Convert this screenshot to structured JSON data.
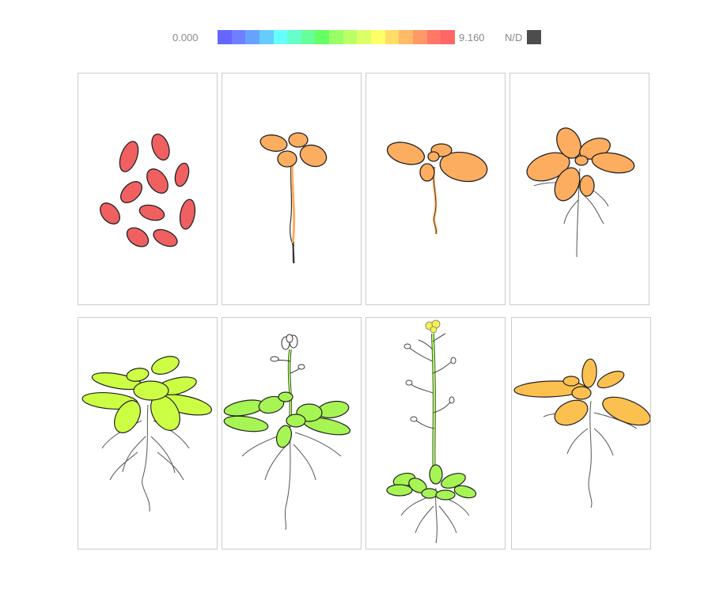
{
  "legend": {
    "min_label": "0.000",
    "max_label": "9.160",
    "nd_label": "N/D",
    "nd_color": "#4d4d4d",
    "scale_colors": [
      "#6666ff",
      "#6f7fff",
      "#66a3ff",
      "#66ccff",
      "#66ffff",
      "#66ffcc",
      "#66ff99",
      "#66ff66",
      "#99ff66",
      "#bbff66",
      "#ddff66",
      "#ffff66",
      "#ffdd66",
      "#ffbb66",
      "#ff9966",
      "#ff7766",
      "#ff6666"
    ]
  },
  "panels": [
    {
      "stage": "seeds",
      "color": "#f06060"
    },
    {
      "stage": "seedling",
      "color": "#fcad60"
    },
    {
      "stage": "cotyledon-seedling",
      "color": "#fcad60"
    },
    {
      "stage": "young-rosette",
      "color": "#fcad60"
    },
    {
      "stage": "rosette",
      "color": "#ccff44"
    },
    {
      "stage": "bolting",
      "color": "#a6f554"
    },
    {
      "stage": "flowering",
      "color": "#a6f554"
    },
    {
      "stage": "senescent-rosette",
      "color": "#fcc050"
    }
  ]
}
